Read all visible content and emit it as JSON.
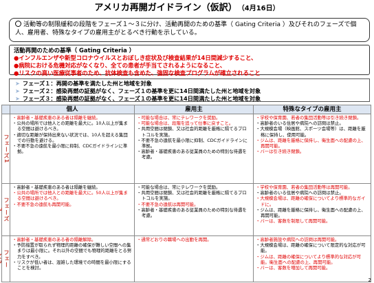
{
  "title": "アメリカ再開ガイドライン（仮訳）",
  "date": "（4月16日）",
  "intro": "活動等の制限緩和の段階をフェーズ１～３に分け、活動再開のための基準（ Gating Criteria ）及びそれのフェーズで個人、雇用者、特殊なタイプの雇用主がとるべき行動を示している。",
  "gating": {
    "heading": "活動再開のための基準（ Gating Criteria ）",
    "items": [
      "●インフルエンザや新型コロナウイルスとおぼしき症状及び検査結果が14日間減少すること、",
      "●病院における危機対応がなくなり、全ての患者が手当てされるようになること、",
      "●リスクの高い医療従事者のため、抗体検査も含めた、強固な検査プログラムが確立されること"
    ]
  },
  "phases": [
    "フェーズ１：再開の基準を満たした州と地域を対象",
    "フェーズ２：感染再燃の証拠がなく、フェーズ１の基準を更に14日間満たした州と地域を対象",
    "フェーズ３：感染再燃の証拠がなく、フェーズ１の基準を更に14日間満たした州と地域を対象"
  ],
  "table": {
    "headers": [
      "個人",
      "雇用主",
      "特殊なタイプの雇用主"
    ],
    "rows": [
      {
        "label": "フェーズ1",
        "individual": [
          "高齢者・基礎疾患のある者は隔離を継続。",
          "公共の場所では他人との距離を最大に。10人以上が集まる空間は避けるべき。",
          "適切な距離が保持出来ない状況では、10人を超える集団での行動を避ける。",
          "不要不急の遠航を最小限に抑制、CDCガイドラインに準拠。"
        ],
        "employer": [
          "可能な場合は、常にテレワークを奨励。",
          "可能な場合は、段階を追って仕事に戻すこと。",
          "共用空間は閉鎖、又は社会的距離を厳格に隔てるプロトコルを実施。",
          "不要不急の遠航を最小限に抑制、CDCガイドラインに準拠。",
          "高齢者・基礎疾患のある従業員のための特別な待遇を考慮。"
        ],
        "special": [
          "学校や保育園、若者の集団活動等は引き続き閉鎖。",
          "高齢者のいる住居や病院への訪問は禁止。",
          "大規模会場（映画館、スポーツ会場等）は、距離を厳格に保持し、使用可能。",
          "ジムは、距離を厳格に保持し、衛生面への配慮の上、再開可能。",
          "バーは引き続き閉鎖。"
        ]
      },
      {
        "label": "フェーズ2",
        "individual": [
          "高齢者・基礎疾患のある者は隔離を継続。",
          "公共の場所では他人との距離を最大に。50人以上が集まる空間は避けるべき。",
          "不要不急の遠航も再開可能。"
        ],
        "employer": [
          "可能な場合は、常にテレワークを奨励。",
          "共用空間は閉鎖、又は社会的距離を厳格に隔てるプロトコルを実施。",
          "不要不急の遠航は再開可能。",
          "高齢者・基礎疾患のある従業員のための特別な待遇を考慮。"
        ],
        "special": [
          "学校や保育園、若者の集団活動等は再開可能。",
          "高齢者のいる住居や病院への訪問は禁止。",
          "大規模会場は、距離の確保についてより標準的なガイドに。",
          "ジムは、距離を厳格に保持し、衛生面への配慮の上、再開可能。",
          "バーは、客数を制限して再開可能。"
        ]
      },
      {
        "label": "フェーズ3",
        "individual": [
          "高齢者・基礎疾患のある者の隔離解除。",
          "予防措置が取られず物理的距離の確保が難しい空間への集まりは最小限に。それ以外の空間でも物理的距離をとる努力をすべき。",
          "リスクが低い者は、混雑した環境での時間を最小限にすることを検討。"
        ],
        "employer": [
          "通常どおりの職場への出勤を再開。"
        ],
        "special": [
          "高齢者施設や病院への訪問は再開可能。",
          "大規模会場は、距離の確保について限定的な対応が可能。",
          "ジムは、距離の確保についてより標準的な対応が可能。衛生面への配慮の上、再開可能。",
          "バーは、客数を増加して再開可能。"
        ]
      }
    ]
  },
  "page_number": "2"
}
